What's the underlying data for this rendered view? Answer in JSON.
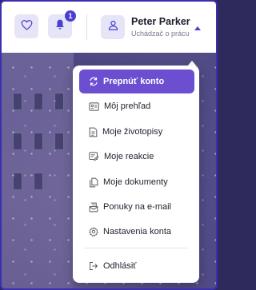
{
  "header": {
    "notifications_count": "1",
    "user_name": "Peter Parker",
    "user_role": "Uchádzač o prácu"
  },
  "menu": {
    "switch_account": "Prepnúť konto",
    "items": [
      {
        "label": "Môj prehľad",
        "icon": "overview-card-icon"
      },
      {
        "label": "Moje životopisy",
        "icon": "cv-document-icon"
      },
      {
        "label": "Moje reakcie",
        "icon": "reactions-icon"
      },
      {
        "label": "Moje dokumenty",
        "icon": "documents-icon"
      },
      {
        "label": "Ponuky na e-mail",
        "icon": "email-offers-icon"
      },
      {
        "label": "Nastavenia konta",
        "icon": "settings-gear-icon"
      }
    ],
    "logout": "Odhlásiť"
  },
  "colors": {
    "accent": "#6c4fd1",
    "brand": "#4a3fcf",
    "icon_bg": "#e6e4f7"
  }
}
